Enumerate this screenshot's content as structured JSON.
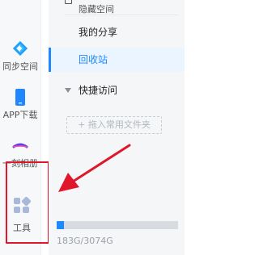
{
  "leftbar": {
    "items": [
      {
        "label": "同步空间",
        "icon": "sync-space-icon"
      },
      {
        "label": "APP下载",
        "icon": "phone-download-icon"
      },
      {
        "label": "一刻相册",
        "icon": "album-icon"
      },
      {
        "label": "工具",
        "icon": "tools-grid-icon"
      }
    ]
  },
  "panel": {
    "hidden_space_label": "隐藏空间",
    "my_share_label": "我的分享",
    "recycle_bin_label": "回收站",
    "quick_access_title": "快捷访问",
    "drag_folder_label": "+ 拖入常用文件夹"
  },
  "storage": {
    "used_fraction": 0.0595,
    "text": "183G/3074G"
  },
  "colors": {
    "accent": "#1f87ff",
    "highlight_box": "#e0162b",
    "arrow": "#e0162b"
  }
}
